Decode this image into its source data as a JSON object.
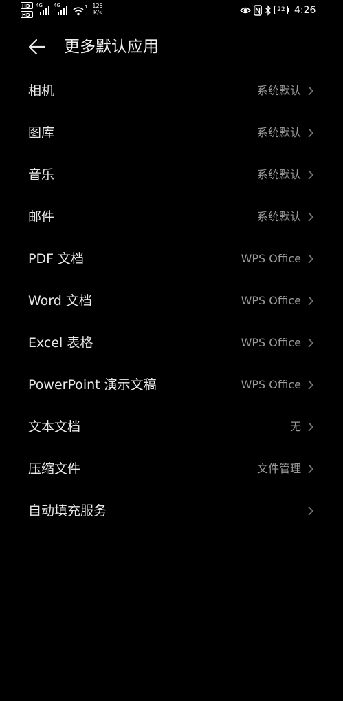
{
  "status_bar": {
    "hd1": "HD",
    "hd2": "HD",
    "net1": "4G",
    "net2": "4G",
    "wifi_sup": "1",
    "speed_value": "125",
    "speed_unit": "K/s",
    "battery": "22",
    "time": "4:26"
  },
  "header": {
    "title": "更多默认应用"
  },
  "rows": [
    {
      "label": "相机",
      "value": "系统默认"
    },
    {
      "label": "图库",
      "value": "系统默认"
    },
    {
      "label": "音乐",
      "value": "系统默认"
    },
    {
      "label": "邮件",
      "value": "系统默认"
    },
    {
      "label": "PDF 文档",
      "value": "WPS Office"
    },
    {
      "label": "Word 文档",
      "value": "WPS Office"
    },
    {
      "label": "Excel 表格",
      "value": "WPS Office"
    },
    {
      "label": "PowerPoint 演示文稿",
      "value": "WPS Office"
    },
    {
      "label": "文本文档",
      "value": "无"
    },
    {
      "label": "压缩文件",
      "value": "文件管理"
    },
    {
      "label": "自动填充服务",
      "value": ""
    }
  ],
  "colors": {
    "background": "#000000",
    "primary_text": "#e8e8e8",
    "secondary_text": "#9a9a9a",
    "divider": "#262626"
  }
}
